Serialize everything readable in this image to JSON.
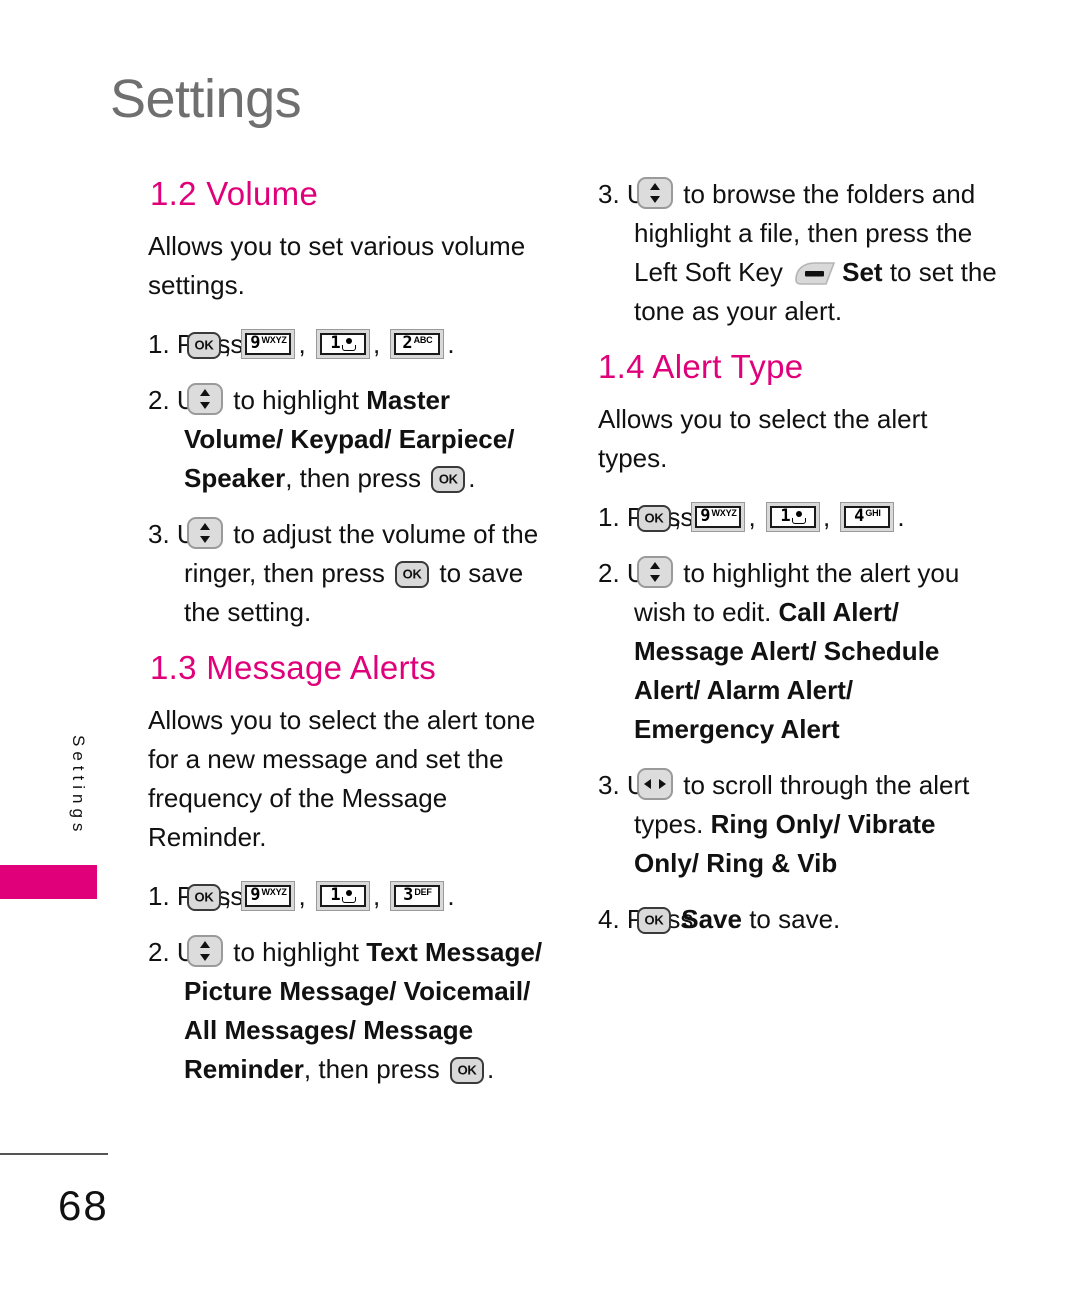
{
  "page": {
    "title": "Settings",
    "side_tab_label": "Settings",
    "page_number": "68"
  },
  "colors": {
    "accent": "#e0007a",
    "title_gray": "#6f6f6f",
    "body_text": "#111111",
    "key_fill": "#d9d9d9"
  },
  "icons": {
    "ok_key": "OK",
    "nav_vertical": "up-down-navigation-key",
    "nav_horizontal": "left-right-navigation-key",
    "left_soft_key": "left-soft-key",
    "key_9": {
      "digit": "9",
      "letters": "WXYZ"
    },
    "key_1": {
      "digit": "1",
      "letters": "voicemail"
    },
    "key_2": {
      "digit": "2",
      "letters": "ABC"
    },
    "key_3": {
      "digit": "3",
      "letters": "DEF"
    },
    "key_4": {
      "digit": "4",
      "letters": "GHI"
    }
  },
  "sections": {
    "volume": {
      "heading": "1.2 Volume",
      "intro": "Allows you to set various volume settings.",
      "step1_prefix": "1. Press",
      "step1_sep": ",",
      "step1_end": ".",
      "step2_prefix": "2. Use",
      "step2_mid": "to highlight",
      "step2_bold_a": "Master Volume/ Keypad/ Earpiece/ Speaker",
      "step2_after": ", then press",
      "step2_end": ".",
      "step3_prefix": "3. Use",
      "step3_mid": "to adjust the volume of the ringer, then press",
      "step3_end": "to save the setting."
    },
    "message_alerts": {
      "heading": "1.3 Message Alerts",
      "intro": "Allows you to select the alert tone for a new message and set the frequency of the Message Reminder.",
      "step1_prefix": "1. Press",
      "step1_sep": ",",
      "step1_end": ".",
      "step2_prefix": "2. Use",
      "step2_mid": "to highlight",
      "step2_bold": "Text Message/ Picture Message/ Voicemail/ All Messages/ Message Reminder",
      "step2_after": ", then press",
      "step2_end": ".",
      "step3_prefix": "3. Use",
      "step3_mid": "to browse the folders and highlight a file, then press the Left Soft Key",
      "step3_bold": "Set",
      "step3_end": "to set the tone as your alert."
    },
    "alert_type": {
      "heading": "1.4 Alert Type",
      "intro": "Allows you to select the alert types.",
      "step1_prefix": "1. Press",
      "step1_sep": ",",
      "step1_end": ".",
      "step2_prefix": "2. Use",
      "step2_mid": "to highlight the alert you wish to edit.",
      "step2_bold": "Call Alert/ Message Alert/ Schedule Alert/ Alarm Alert/ Emergency Alert",
      "step3_prefix": "3. Use",
      "step3_mid": "to scroll through the alert types.",
      "step3_bold": "Ring Only/ Vibrate Only/ Ring & Vib",
      "step4_prefix": "4. Press",
      "step4_bold": "Save",
      "step4_end": "to save."
    }
  }
}
